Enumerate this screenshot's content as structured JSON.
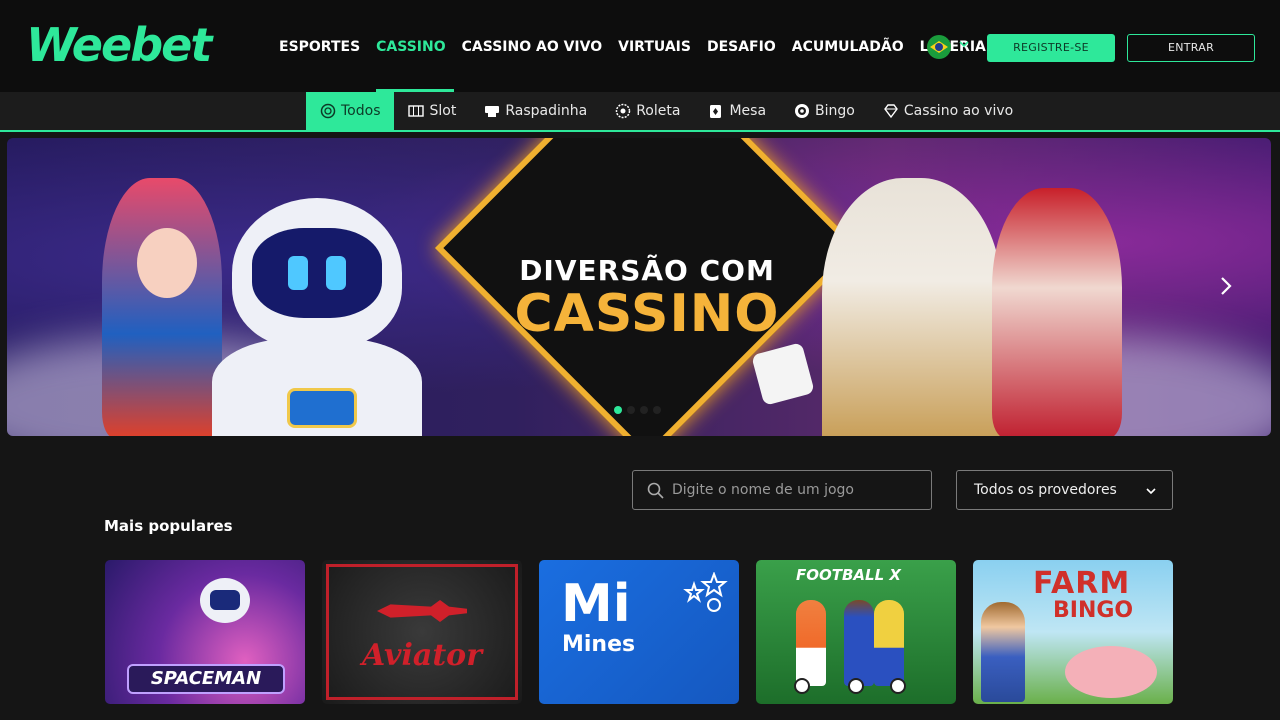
{
  "header": {
    "logo": "Weebet",
    "nav": [
      "ESPORTES",
      "CASSINO",
      "CASSINO AO VIVO",
      "VIRTUAIS",
      "DESAFIO",
      "ACUMULADÃO",
      "LOTERIA"
    ],
    "active_nav": "CASSINO",
    "register_label": "REGISTRE-SE",
    "login_label": "ENTRAR",
    "language_icon": "brazil-flag-icon"
  },
  "subnav": {
    "items": [
      {
        "label": "Todos",
        "icon": "chip-icon"
      },
      {
        "label": "Slot",
        "icon": "slot-machine-icon"
      },
      {
        "label": "Raspadinha",
        "icon": "scratch-card-icon"
      },
      {
        "label": "Roleta",
        "icon": "roulette-icon"
      },
      {
        "label": "Mesa",
        "icon": "cards-icon"
      },
      {
        "label": "Bingo",
        "icon": "bingo-ball-icon"
      },
      {
        "label": "Cassino ao vivo",
        "icon": "diamond-icon"
      }
    ],
    "active": "Todos"
  },
  "banner": {
    "line1": "DIVERSÃO COM",
    "line2": "CASSINO",
    "slides": 4,
    "active_slide": 1
  },
  "filters": {
    "search_placeholder": "Digite o nome de um jogo",
    "provider_selected": "Todos os provedores"
  },
  "section": {
    "title": "Mais populares",
    "games": [
      {
        "name": "SPACEMAN"
      },
      {
        "name": "Aviator"
      },
      {
        "name": "Mi",
        "sub": "Mines"
      },
      {
        "name": "FOOTBALL X"
      },
      {
        "name": "FARM",
        "sub": "BINGO"
      }
    ]
  },
  "colors": {
    "accent": "#2ee89a",
    "background": "#151515",
    "header": "#0d0d0d"
  }
}
